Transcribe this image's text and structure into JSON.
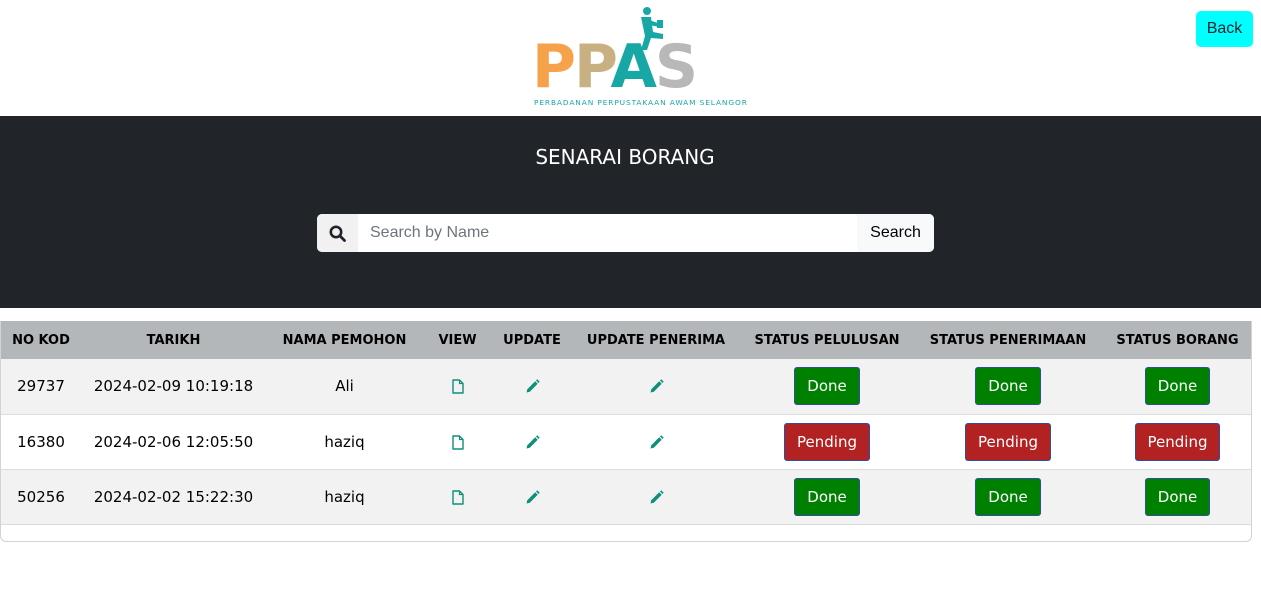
{
  "header": {
    "logo_text": "PPAS",
    "logo_letters": [
      "P",
      "P",
      "A",
      "S"
    ],
    "logo_tagline": "PERBADANAN PERPUSTAKAAN AWAM SELANGOR",
    "back_label": "Back"
  },
  "hero": {
    "title": "SENARAI BORANG",
    "search_placeholder": "Search by Name",
    "search_value": "",
    "search_button": "Search",
    "search_icon": "magnifier-icon"
  },
  "table": {
    "columns": [
      "NO KOD",
      "TARIKH",
      "NAMA PEMOHON",
      "VIEW",
      "UPDATE",
      "UPDATE PENERIMA",
      "STATUS PELULUSAN",
      "STATUS PENERIMAAN",
      "STATUS BORANG"
    ],
    "rows": [
      {
        "no_kod": "29737",
        "tarikh": "2024-02-09 10:19:18",
        "nama": "Ali",
        "status_pelulusan": "Done",
        "status_penerimaan": "Done",
        "status_borang": "Done"
      },
      {
        "no_kod": "16380",
        "tarikh": "2024-02-06 12:05:50",
        "nama": "haziq",
        "status_pelulusan": "Pending",
        "status_penerimaan": "Pending",
        "status_borang": "Pending"
      },
      {
        "no_kod": "50256",
        "tarikh": "2024-02-02 15:22:30",
        "nama": "haziq",
        "status_pelulusan": "Done",
        "status_penerimaan": "Done",
        "status_borang": "Done"
      }
    ],
    "icons": {
      "view": "document-icon",
      "update": "pencil-icon",
      "update_penerima": "pencil-icon"
    }
  },
  "colors": {
    "done": "#008000",
    "pending": "#b22222",
    "dark_band": "#212529",
    "back_button": "#00ffff",
    "icon": "#0f8f7a",
    "table_header": "#b4b7b9"
  }
}
